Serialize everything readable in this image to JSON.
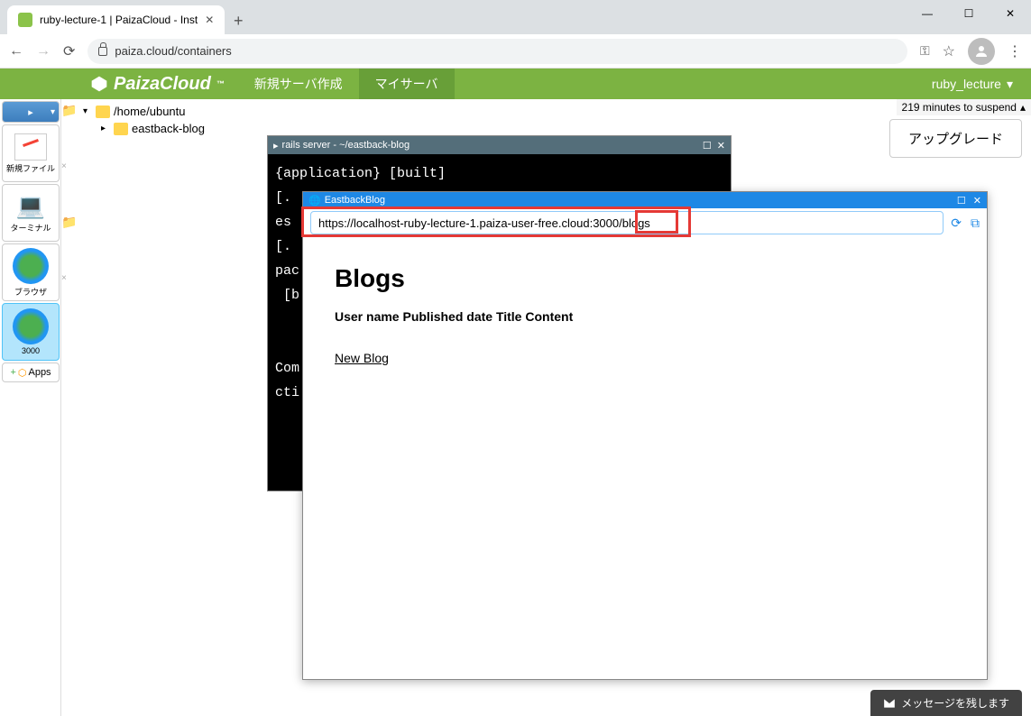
{
  "chrome": {
    "tab_title": "ruby-lecture-1 | PaizaCloud - Inst",
    "url": "paiza.cloud/containers"
  },
  "paiza": {
    "logo": "PaizaCloud",
    "nav_new_server": "新規サーバ作成",
    "nav_my_server": "マイサーバ",
    "user": "ruby_lecture"
  },
  "taskbar": {
    "new_file": "新規ファイル",
    "terminal": "ターミナル",
    "browser": "ブラウザ",
    "port": "3000",
    "apps": "Apps"
  },
  "tree": {
    "root": "/home/ubuntu",
    "child": "eastback-blog"
  },
  "status": {
    "suspend": "219 minutes to suspend",
    "upgrade": "アップグレード"
  },
  "terminal_window": {
    "title": "rails server - ~/eastback-blog",
    "lines": "{application} [built]\n[.\nes\n[.\npac\n [b\n\n\nCom\ncti"
  },
  "browser_window": {
    "title": "EastbackBlog",
    "url": "https://localhost-ruby-lecture-1.paiza-user-free.cloud:3000/blogs",
    "heading": "Blogs",
    "columns": "User name Published date Title Content",
    "link": "New Blog"
  },
  "message_btn": "メッセージを残します"
}
